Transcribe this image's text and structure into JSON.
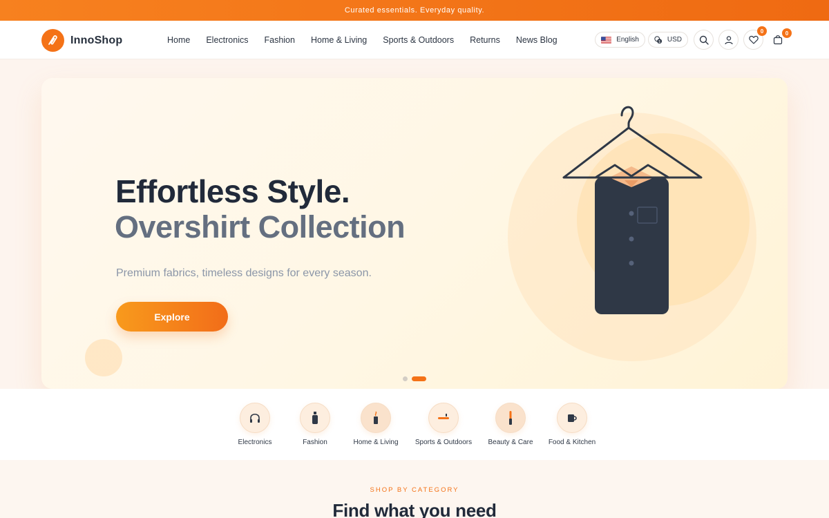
{
  "topbar": {
    "text": "Curated essentials. Everyday quality."
  },
  "header": {
    "brand": "InnoShop",
    "nav": [
      "Home",
      "Electronics",
      "Fashion",
      "Home & Living",
      "Sports & Outdoors",
      "Returns",
      "News Blog"
    ],
    "language": "English",
    "currency": "USD",
    "wishlist_count": "0",
    "cart_count": "0"
  },
  "hero": {
    "title": "Effortless Style.",
    "subtitle": "Overshirt Collection",
    "description": "Premium fabrics, timeless designs for every season.",
    "cta": "Explore",
    "slides": 2,
    "active_slide": 2
  },
  "categories": [
    {
      "label": "Electronics",
      "icon": "headphones-icon"
    },
    {
      "label": "Fashion",
      "icon": "bottle-icon"
    },
    {
      "label": "Home & Living",
      "icon": "candle-icon"
    },
    {
      "label": "Sports & Outdoors",
      "icon": "bat-icon"
    },
    {
      "label": "Beauty & Care",
      "icon": "brush-icon"
    },
    {
      "label": "Food & Kitchen",
      "icon": "mug-icon"
    }
  ],
  "section": {
    "eyebrow": "SHOP BY CATEGORY",
    "title": "Find what you need"
  },
  "colors": {
    "accent": "#f47217",
    "text_dark": "#212a3a"
  }
}
